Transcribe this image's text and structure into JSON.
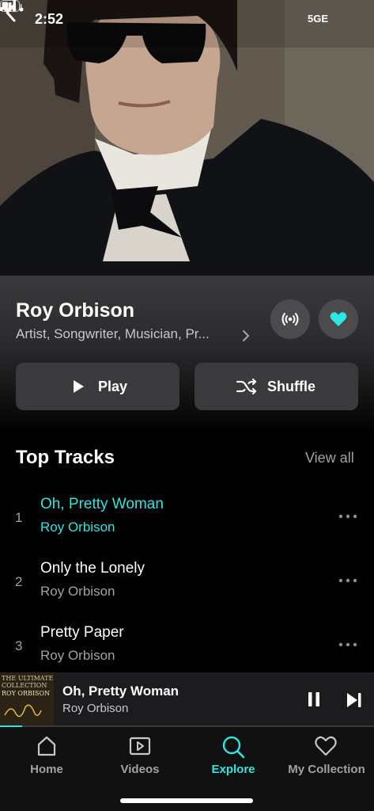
{
  "status_bar": {
    "time": "2:52",
    "network": "5GE"
  },
  "artist": {
    "name": "Roy Orbison",
    "roles": "Artist, Songwriter, Musician, Pr..."
  },
  "actions": {
    "play_label": "Play",
    "shuffle_label": "Shuffle"
  },
  "top_tracks": {
    "title": "Top Tracks",
    "view_all": "View all",
    "tracks": [
      {
        "num": "1",
        "title": "Oh, Pretty Woman",
        "artist": "Roy Orbison",
        "playing": true
      },
      {
        "num": "2",
        "title": "Only the Lonely",
        "artist": "Roy Orbison",
        "playing": false
      },
      {
        "num": "3",
        "title": "Pretty Paper",
        "artist": "Roy Orbison",
        "playing": false
      }
    ]
  },
  "now_playing": {
    "title": "Oh, Pretty Woman",
    "artist": "Roy Orbison",
    "album_art_lines": [
      "THE ULTIMATE",
      "COLLECTION",
      "ROY ORBISON"
    ],
    "progress": 0.06
  },
  "bottom_nav": {
    "items": [
      {
        "label": "Home",
        "icon": "home-icon",
        "active": false
      },
      {
        "label": "Videos",
        "icon": "video-icon",
        "active": false
      },
      {
        "label": "Explore",
        "icon": "search-icon",
        "active": true
      },
      {
        "label": "My Collection",
        "icon": "heart-icon",
        "active": false
      }
    ]
  },
  "colors": {
    "accent": "#2ee6e0",
    "background": "#000000",
    "secondary_text": "#a1a1a6",
    "button_bg": "#3a3a3c"
  }
}
